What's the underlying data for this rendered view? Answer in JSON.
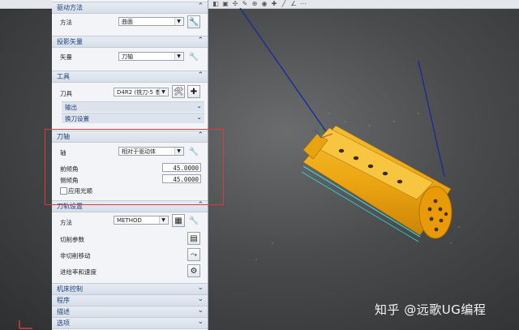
{
  "panel": {
    "drive_method": {
      "title": "驱动方法",
      "method_label": "方法",
      "method_value": "曲面"
    },
    "projection_vector": {
      "title": "投影矢量",
      "vector_label": "矢量",
      "vector_value": "刀轴"
    },
    "tool": {
      "title": "工具",
      "tool_label": "刀具",
      "tool_value": "D4R2 (铣刀-5 参",
      "output_label": "输出",
      "change_tool_label": "换刀设置"
    },
    "tool_axis": {
      "title": "刀轴",
      "axis_label": "轴",
      "axis_value": "相对于驱动体",
      "lead_label": "前倾角",
      "lead_value": "45.0000",
      "tilt_label": "侧倾角",
      "tilt_value": "45.0000",
      "smooth_label": "应用光顺"
    },
    "tool_path_settings": {
      "title": "刀轨设置",
      "method_label": "方法",
      "method_value": "METHOD",
      "cut_params_label": "切削参数",
      "non_cut_label": "非切削移动",
      "feeds_label": "进给率和速度"
    },
    "machine_control": "机床控制",
    "program": "程序",
    "description": "描述",
    "options": "选项"
  },
  "watermark": "知乎 @远歌UG编程",
  "colors": {
    "part": "#f0a812",
    "accent_red": "#d83b3b",
    "section_title": "#1d3f7a",
    "tool_axis_lines": "#1a2c9a"
  }
}
